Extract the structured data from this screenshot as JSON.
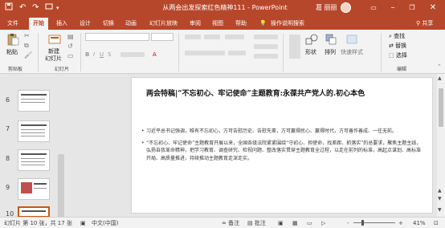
{
  "titlebar": {
    "document_title": "从两会出发探索红色精神111 - PowerPoint",
    "user_name": "葛 丽丽",
    "icons": [
      "save-icon",
      "undo-icon",
      "redo-icon",
      "present-icon",
      "customize-icon",
      "ribbon-options-icon",
      "minimize-icon",
      "restore-icon",
      "close-icon"
    ]
  },
  "tabs": [
    "文件",
    "开始",
    "插入",
    "设计",
    "切换",
    "动画",
    "幻灯片放映",
    "审阅",
    "视图",
    "帮助"
  ],
  "active_tab": "开始",
  "tell_me": "操作说明搜索",
  "share": "共享",
  "ribbon": {
    "paste": "粘贴",
    "clipboard_label": "剪贴板",
    "new_slide_1": "新建",
    "new_slide_2": "幻灯片",
    "slides_label": "幻灯片",
    "font_bold": "B",
    "font_italic": "I",
    "font_underline": "U",
    "font_strike": "S",
    "font_a": "A",
    "draw_label": "形状",
    "arrange_label": "排列",
    "quick_styles": "快速样式",
    "find": "查找",
    "replace": "替换",
    "select": "选择",
    "editing_label": "编辑"
  },
  "thumbnails": [
    {
      "num": "6"
    },
    {
      "num": "7"
    },
    {
      "num": "8"
    },
    {
      "num": "9"
    },
    {
      "num": "10"
    }
  ],
  "slide": {
    "title": "两会特稿|“不忘初心、牢记使命”主题教育:永葆共产党人的.初心本色",
    "paragraphs": [
      "习近平总书记强调，唯有不忘初心，方可告慰历史、告慰先辈，方可赢得民心、赢得时代，方可善作善成、一往无前。",
      "“不忘初心、牢记使命”主题教育开展以来，全国各级法院紧紧围绕“守初心、担使命，找差距、抓落实”的总要求，聚焦主题主线，弘扬自我革命精神，把学习教育、调查研究、检视问题、整改落实贯穿主题教育全过程，以走在前列的标准，高起点谋划、高标准开局、高质量推进，持续推动主题教育走深走实。"
    ]
  },
  "statusbar": {
    "slide_info": "幻灯片 第 10 张，共 17 张",
    "language": "中文(中国)",
    "notes": "备注",
    "comments": "批注",
    "zoom_minus": "-",
    "zoom_plus": "+",
    "zoom": "41%",
    "zoom_fraction": 0.41
  }
}
